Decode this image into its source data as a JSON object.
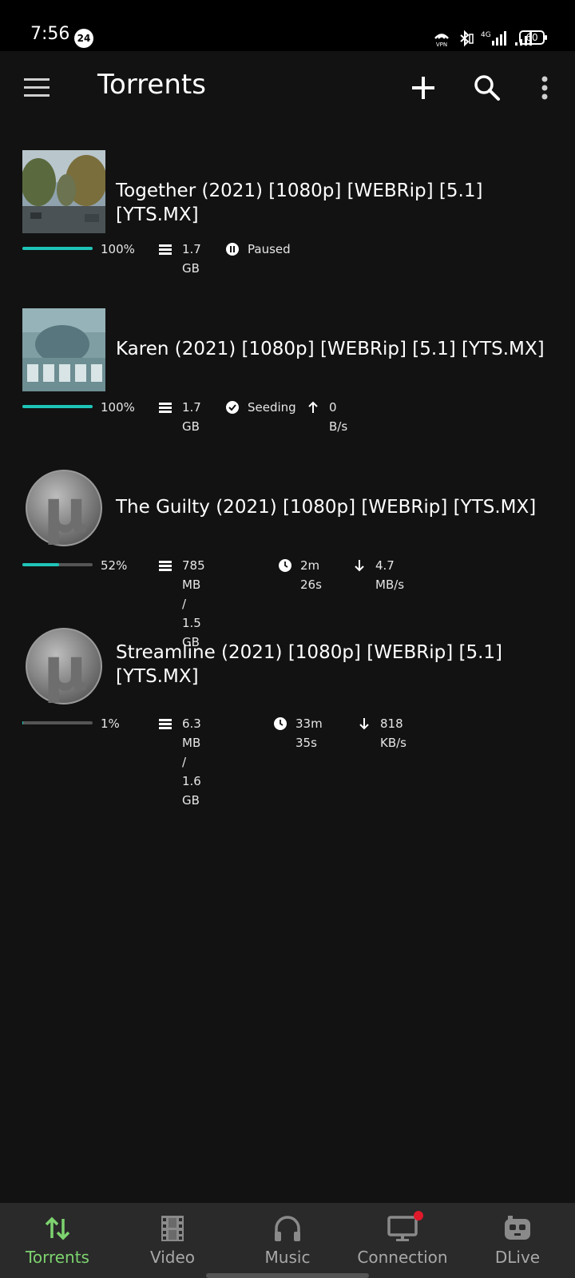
{
  "status": {
    "time": "7:56",
    "badge": "24",
    "network": "4G",
    "battery": "60",
    "icons": [
      "vpn-icon",
      "bluetooth-icon",
      "signal-4g-icon",
      "signal-icon"
    ]
  },
  "appbar": {
    "title": "Torrents",
    "icons": [
      "menu-icon",
      "add-icon",
      "search-icon",
      "more-vert-icon"
    ]
  },
  "torrents": [
    {
      "name": "Together (2021) [1080p] [WEBRip] [5.1] [YTS.MX]",
      "thumb": "poster-street",
      "progress_pct": 100,
      "progress_label": "100%",
      "size": "1.7 GB",
      "status_icon": "pause-circle-icon",
      "status": "Paused",
      "speed_icon": "",
      "speed": ""
    },
    {
      "name": "Karen (2021) [1080p] [WEBRip] [5.1] [YTS.MX]",
      "thumb": "poster-karen",
      "progress_pct": 100,
      "progress_label": "100%",
      "size": "1.7 GB",
      "status_icon": "check-circle-icon",
      "status": "Seeding",
      "speed_icon": "arrow-up-icon",
      "speed": "0 B/s"
    },
    {
      "name": "The Guilty (2021) [1080p] [WEBRip] [YTS.MX]",
      "thumb": "utorrent-logo",
      "progress_pct": 52,
      "progress_label": "52%",
      "size": "785 MB / 1.5 GB",
      "status_icon": "clock-icon",
      "status": "2m 26s",
      "speed_icon": "arrow-down-icon",
      "speed": "4.7 MB/s"
    },
    {
      "name": "Streamline (2021) [1080p] [WEBRip] [5.1] [YTS.MX]",
      "thumb": "utorrent-logo",
      "progress_pct": 1,
      "progress_label": "1%",
      "size": "6.3 MB / 1.6 GB",
      "status_icon": "clock-icon",
      "status": "33m 35s",
      "speed_icon": "arrow-down-icon",
      "speed": "818 KB/s"
    }
  ],
  "bottom_nav": [
    {
      "label": "Torrents",
      "icon": "torrents-arrows-icon",
      "active": true
    },
    {
      "label": "Video",
      "icon": "film-icon",
      "active": false
    },
    {
      "label": "Music",
      "icon": "headphones-icon",
      "active": false
    },
    {
      "label": "Connection",
      "icon": "monitor-icon",
      "active": false,
      "notification": true
    },
    {
      "label": "DLive",
      "icon": "dlive-icon",
      "active": false
    }
  ],
  "colors": {
    "background": "#121212",
    "accent_progress": "#1fc4b8",
    "active_nav": "#7dd36f",
    "nav_background": "#2a2a2a",
    "notification": "#e0192b"
  }
}
